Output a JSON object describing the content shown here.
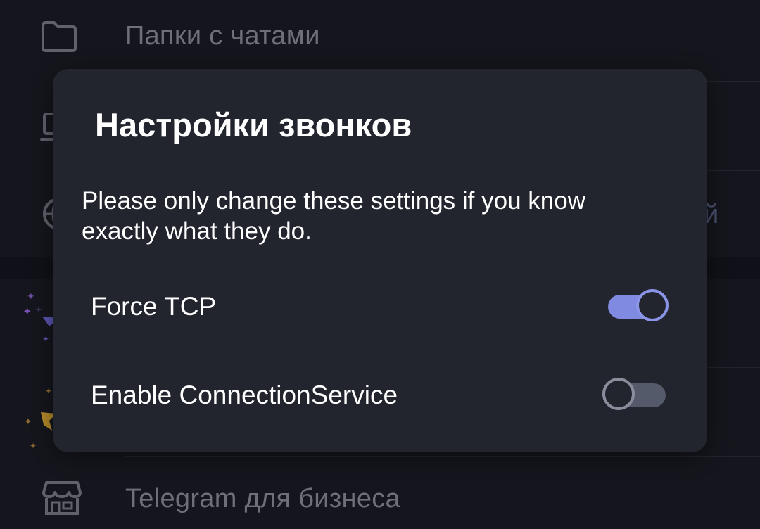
{
  "background": {
    "items": [
      {
        "label": "Папки с чатами",
        "icon": "folder-icon"
      },
      {
        "label": "",
        "icon": "laptop-icon"
      },
      {
        "label": "",
        "icon": "globe-icon"
      },
      {
        "label": "",
        "icon": "premium-star-icon"
      },
      {
        "label": "",
        "icon": "gift-star-icon"
      },
      {
        "label": "Telegram для бизнеса",
        "icon": "store-icon"
      }
    ],
    "partial_trailing_text": "й"
  },
  "dialog": {
    "title": "Настройки звонков",
    "message": "Please only change these settings if you know exactly what they do.",
    "settings": [
      {
        "label": "Force TCP",
        "enabled": true
      },
      {
        "label": "Enable ConnectionService",
        "enabled": false
      }
    ]
  },
  "colors": {
    "accent": "#7f8ae0",
    "dialog_bg": "#22242e",
    "page_bg": "#15161d"
  }
}
